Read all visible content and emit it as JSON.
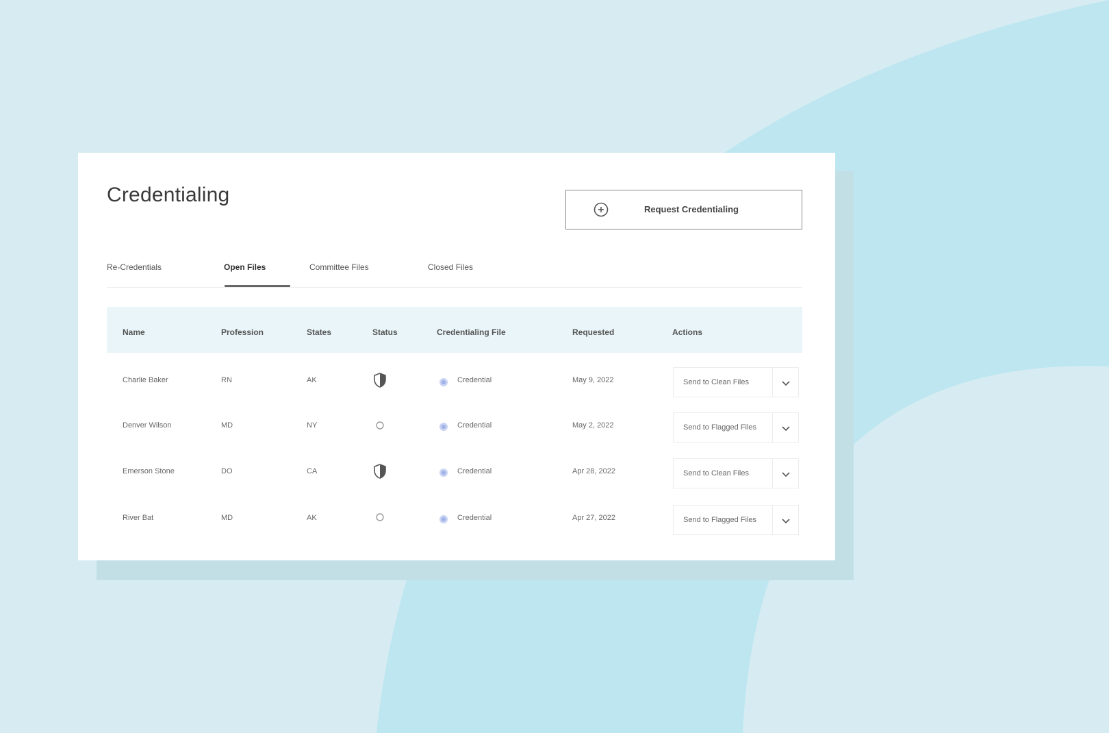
{
  "colors": {
    "page_background": "#d6ecf2",
    "arc_shape": "#bde6f0",
    "card": "#ffffff",
    "table_header_background": "#e9f5f8",
    "file_dot": "#9fb2e8"
  },
  "header": {
    "title": "Credentialing",
    "request_button_label": "Request Credentialing",
    "request_button_icon": "plus-circle-icon"
  },
  "tabs": [
    {
      "label": "Re-Credentials",
      "active": false
    },
    {
      "label": "Open Files",
      "active": true
    },
    {
      "label": "Committee Files",
      "active": false
    },
    {
      "label": "Closed Files",
      "active": false
    }
  ],
  "table": {
    "columns": [
      "Name",
      "Profession",
      "States",
      "Status",
      "Credentialing File",
      "Requested",
      "Actions"
    ],
    "rows": [
      {
        "name": "Charlie Baker",
        "profession": "RN",
        "state": "AK",
        "status_icon": "shield-icon",
        "file": "Credential",
        "requested": "May 9, 2022",
        "action": "Send to Clean Files"
      },
      {
        "name": "Denver Wilson",
        "profession": "MD",
        "state": "NY",
        "status_icon": "dot-icon",
        "file": "Credential",
        "requested": "May 2, 2022",
        "action": "Send to Flagged Files"
      },
      {
        "name": "Emerson Stone",
        "profession": "DO",
        "state": "CA",
        "status_icon": "shield-icon",
        "file": "Credential",
        "requested": "Apr 28, 2022",
        "action": "Send to Clean Files"
      },
      {
        "name": "River Bat",
        "profession": "MD",
        "state": "AK",
        "status_icon": "dot-icon",
        "file": "Credential",
        "requested": "Apr 27, 2022",
        "action": "Send to Flagged Files"
      }
    ]
  }
}
